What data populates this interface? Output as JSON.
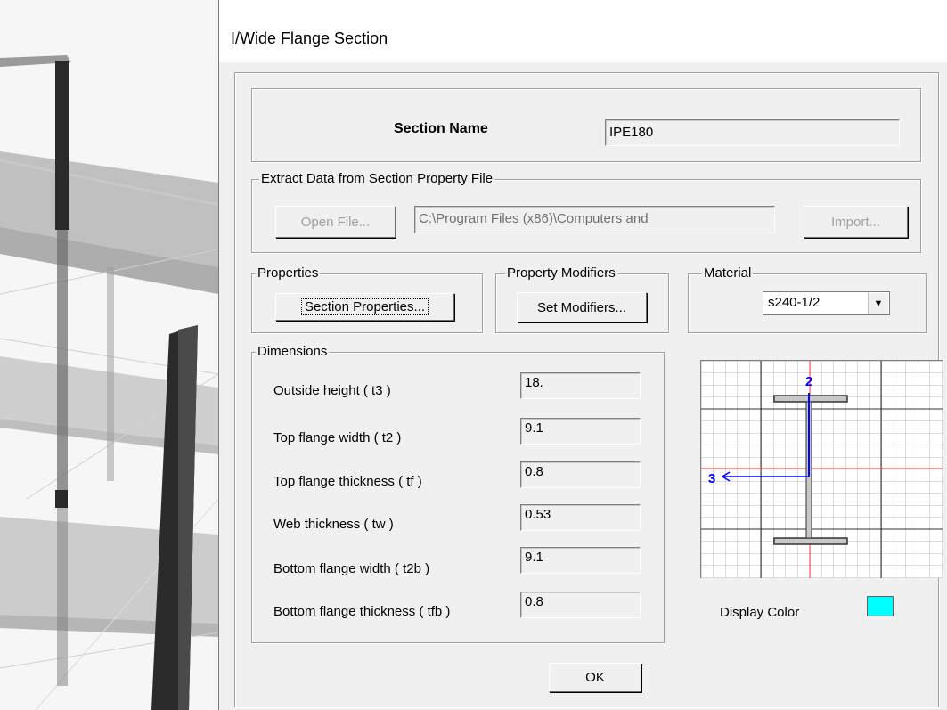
{
  "dialog": {
    "title": "I/Wide Flange Section",
    "section_name_label": "Section Name",
    "section_name_value": "IPE180"
  },
  "extract": {
    "legend": "Extract Data from Section Property File",
    "open_file_label": "Open File...",
    "file_path": "C:\\Program Files (x86)\\Computers and",
    "import_label": "Import..."
  },
  "properties": {
    "legend": "Properties",
    "section_properties_label": "Section Properties..."
  },
  "modifiers": {
    "legend": "Property Modifiers",
    "set_modifiers_label": "Set Modifiers..."
  },
  "material": {
    "legend": "Material",
    "selected": "s240-1/2",
    "dropdown_icon": "triangle-down"
  },
  "dimensions": {
    "legend": "Dimensions",
    "rows": [
      {
        "label": "Outside height  ( t3 )",
        "value": "18."
      },
      {
        "label": "Top flange width  ( t2 )",
        "value": "9.1"
      },
      {
        "label": "Top flange thickness  ( tf )",
        "value": "0.8"
      },
      {
        "label": "Web thickness  ( tw )",
        "value": "0.53"
      },
      {
        "label": "Bottom flange width  ( t2b )",
        "value": "9.1"
      },
      {
        "label": "Bottom flange thickness  ( tfb )",
        "value": "0.8"
      }
    ]
  },
  "preview": {
    "axis_2_label": "2",
    "axis_3_label": "3"
  },
  "display_color": {
    "label": "Display Color",
    "color": "#00ffff"
  },
  "ok_label": "OK"
}
